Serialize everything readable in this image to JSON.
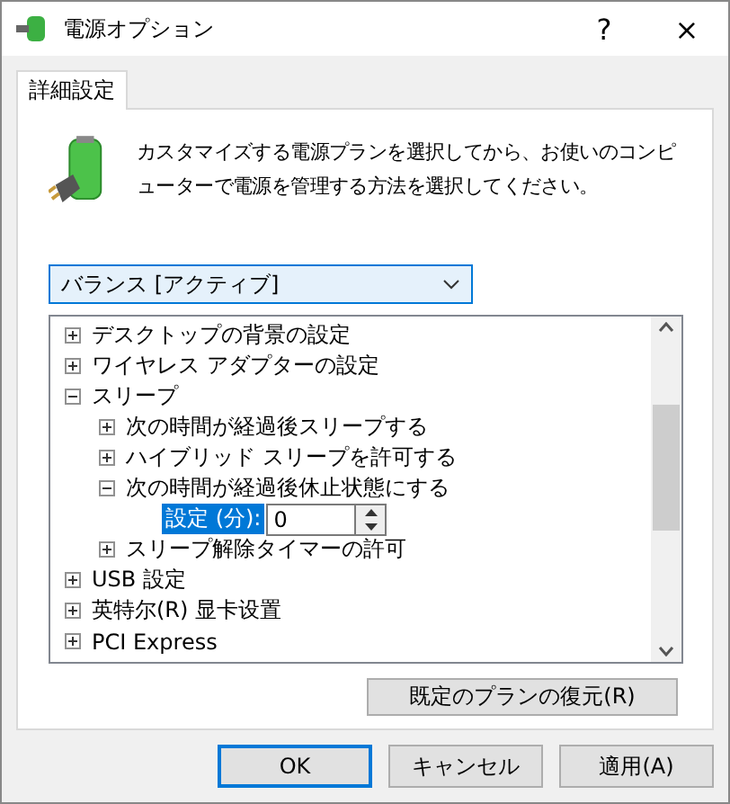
{
  "window": {
    "title": "電源オプション",
    "buttons": [
      "?",
      "×"
    ]
  },
  "tabs": [
    {
      "label": "詳細設定",
      "selected": true
    }
  ],
  "description": "カスタマイズする電源プランを選択してから、お使いのコンピューターで電源を管理する方法を選択してください。",
  "plan_dropdown": {
    "value": "バランス [アクティブ]"
  },
  "tree": [
    {
      "label": "デスクトップの背景の設定",
      "expanded": false
    },
    {
      "label": "ワイヤレス アダプターの設定",
      "expanded": false
    },
    {
      "label": "スリープ",
      "expanded": true,
      "children": [
        {
          "label": "次の時間が経過後スリープする",
          "expanded": false
        },
        {
          "label": "ハイブリッド スリープを許可する",
          "expanded": false
        },
        {
          "label": "次の時間が経過後休止状態にする",
          "expanded": true,
          "setting": {
            "label": "設定 (分):",
            "value": "0",
            "selected": true
          }
        },
        {
          "label": "スリープ解除タイマーの許可",
          "expanded": false
        }
      ]
    },
    {
      "label": "USB 設定",
      "expanded": false
    },
    {
      "label": "英特尔(R) 显卡设置",
      "expanded": false
    },
    {
      "label": "PCI Express",
      "expanded": false
    }
  ],
  "restore_button": "既定のプランの復元(R)",
  "dialog_buttons": [
    {
      "label": "OK",
      "default": true
    },
    {
      "label": "キャンセル",
      "default": false
    },
    {
      "label": "適用(A)",
      "default": false
    }
  ]
}
